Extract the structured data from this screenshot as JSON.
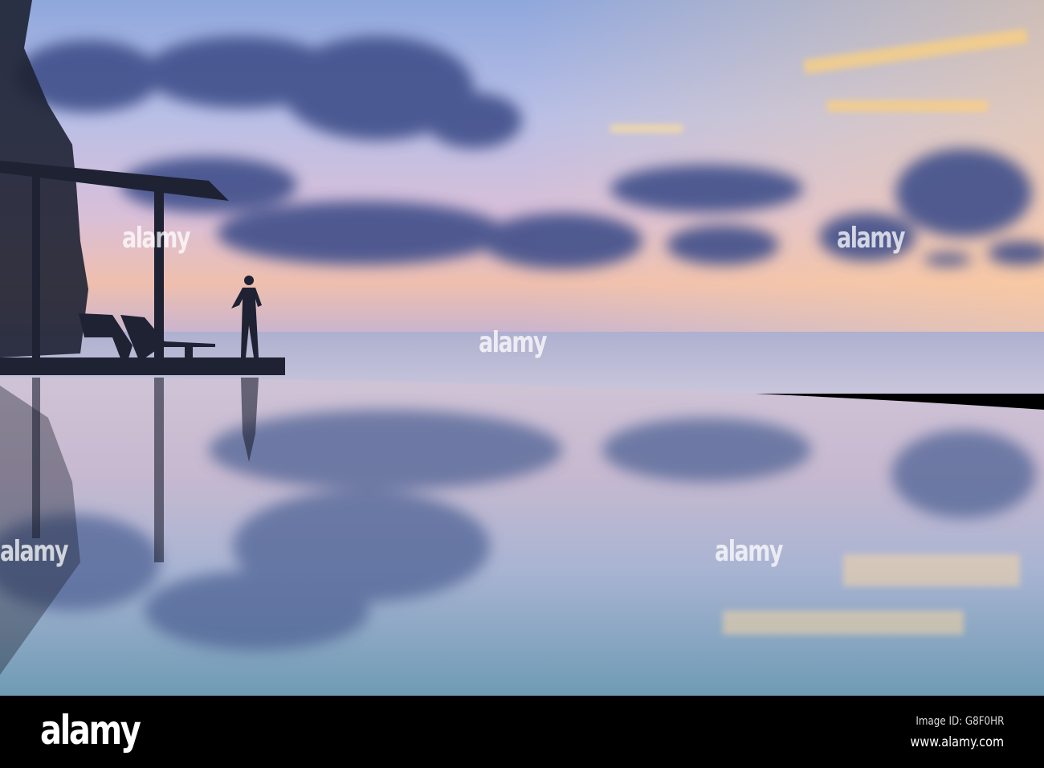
{
  "watermark": {
    "text": "alamy"
  },
  "footer": {
    "logo": "alamy",
    "image_id": "Image ID: G8F0HR",
    "website": "www.alamy.com"
  }
}
